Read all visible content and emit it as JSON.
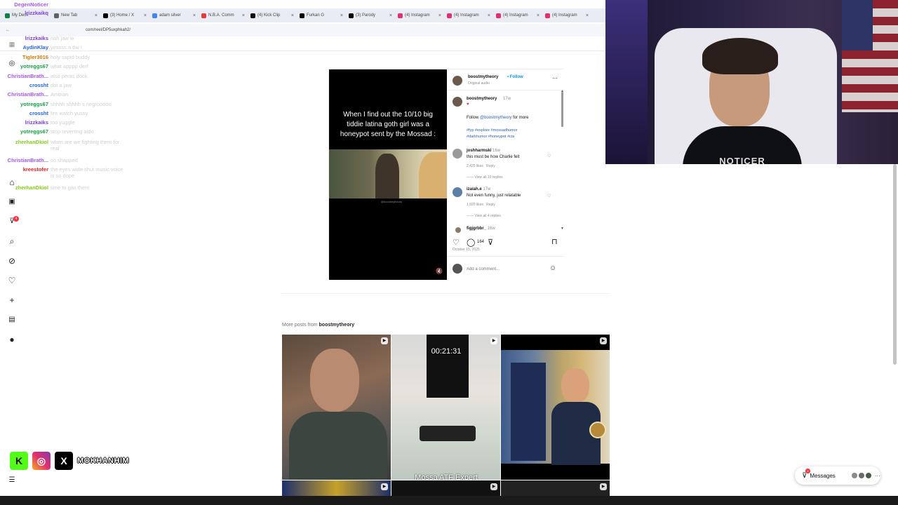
{
  "browser": {
    "tabs": [
      {
        "label": "New Tab",
        "color": "#5f6368"
      },
      {
        "label": "(3) Home / X",
        "color": "#000000"
      },
      {
        "label": "adam silver",
        "color": "#4285f4"
      },
      {
        "label": "N.B.A. Comm",
        "color": "#e33b3b"
      },
      {
        "label": "(4) Kick Clip",
        "color": "#111111"
      },
      {
        "label": "Furkan G",
        "color": "#000000"
      },
      {
        "label": "(3) Parody",
        "color": "#000000"
      },
      {
        "label": "(4) Instagram",
        "color": "#e1306c"
      },
      {
        "label": "(4) Instagram",
        "color": "#e1306c"
      },
      {
        "label": "(4) Instagram",
        "color": "#e1306c"
      },
      {
        "label": "(4) Instagram",
        "color": "#e1306c"
      }
    ],
    "first_tab": "My Deck",
    "url": "com/reel/DP5uxphkah2/"
  },
  "chat": [
    {
      "user": "DegenNoticer",
      "text": "",
      "color": "#a855f7"
    },
    {
      "user": "lrizzkaikq",
      "text": "",
      "color": "#7c3aed"
    },
    {
      "user": "lrizzkaiks",
      "text": "nah jaw w",
      "color": "#7c3aed"
    },
    {
      "user": "AydinKlay",
      "text": "yessss a 6w !",
      "color": "#2563eb"
    },
    {
      "user": "Tigler3016",
      "text": "holy sapid buddy",
      "color": "#d97706"
    },
    {
      "user": "yotreggs67",
      "text": "what apppp derf",
      "color": "#16a34a"
    },
    {
      "user": "ChristianBrath...",
      "text": "also peras dock.",
      "color": "#a855f7"
    },
    {
      "user": "crossht",
      "text": "dat a jaw",
      "color": "#2563eb"
    },
    {
      "user": "ChristianBrath...",
      "text": "Ambian",
      "color": "#a855f7"
    },
    {
      "user": "yotreggs67",
      "text": "shhhh shhhh s negrooooo",
      "color": "#16a34a"
    },
    {
      "user": "crossht",
      "text": "fire watch yussy",
      "color": "#2563eb"
    },
    {
      "user": "lrizzkaiks",
      "text": "too yuggle",
      "color": "#7c3aed"
    },
    {
      "user": "yotreggs67",
      "text": "stop reverting aldo",
      "color": "#16a34a"
    },
    {
      "user": "zherhanDkiol",
      "text": "when are we fighting them for real",
      "color": "#84cc16"
    },
    {
      "user": "ChristianBrath...",
      "text": "so shapped",
      "color": "#a855f7"
    },
    {
      "user": "kreestofer",
      "text": "the eyes wide shut music voice is so dope",
      "color": "#dc2626"
    },
    {
      "user": "zherhanDkiol",
      "text": "time to gas them",
      "color": "#84cc16"
    }
  ],
  "webcam": {
    "shirt_text": "NOTICER"
  },
  "sidebar": {
    "notif_count": "4"
  },
  "post": {
    "caption": "When I find out the 10/10 big tiddie latina goth girl was a honeypot sent by the Mossad :",
    "video_watermark": "@boostmytheory",
    "author": "boostmytheory",
    "follow": "Follow",
    "audio": "Original audio",
    "desc_author": "boostmytheory",
    "desc_time": "17w",
    "desc_line1_pre": "Follow",
    "desc_line1_handle": "@boostmytheory",
    "desc_line1_post": "for more",
    "hashtags1": "#fyp #explore #mossadhumor",
    "hashtags2": "#darkhumor #honeypot #cia",
    "comments": [
      {
        "user": "joshharmski",
        "time": "16w",
        "text": "this must be how Charlie felt",
        "likes": "2,425 likes",
        "reply": "Reply",
        "view": "View all 10 replies"
      },
      {
        "user": "izaiah.e",
        "time": "17w",
        "text": "Not even funny, just relatable",
        "likes": "1,820 likes",
        "reply": "Reply",
        "view": "View all 4 replies"
      },
      {
        "user": "figjgrbbr_",
        "time": "16w",
        "text": "",
        "likes": "",
        "reply": "",
        "view": ""
      }
    ],
    "comment_count": "164",
    "date": "October 15, 2025",
    "add_comment_placeholder": "Add a comment..."
  },
  "more_posts": {
    "label_pre": "More posts from",
    "label_user": "boostmytheory",
    "thumb2_timer": "00:21:31",
    "thumb2_bottom": "Mossa ATF Expert"
  },
  "socials": {
    "handle": "MOKHANHIM"
  },
  "messages": {
    "label": "Messages",
    "badge": "4"
  }
}
